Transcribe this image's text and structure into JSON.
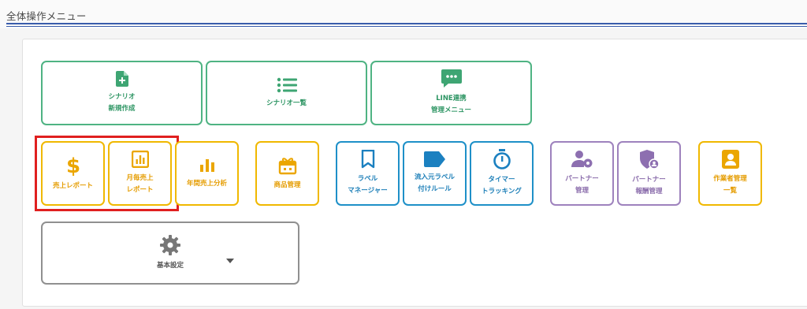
{
  "page": {
    "title": "全体操作メニュー"
  },
  "colors": {
    "green": "#4fb383",
    "orange": "#f0b800",
    "blue": "#1e90c8",
    "purple": "#9e82bd",
    "gray": "#909090",
    "highlight": "#e02020"
  },
  "scenario_menu": [
    {
      "label": "シナリオ\n新規作成",
      "icon": "file-plus-icon"
    },
    {
      "label": "シナリオ一覧",
      "icon": "list-icon"
    },
    {
      "label": "LINE連携\n管理メニュー",
      "icon": "chat-icon"
    }
  ],
  "sales_menu": [
    {
      "label": "売上レポート",
      "icon": "dollar-icon"
    },
    {
      "label": "月毎売上\nレポート",
      "icon": "bar-chart-square-icon"
    },
    {
      "label": "年間売上分析",
      "icon": "bar-chart-icon"
    },
    {
      "label": "商品管理",
      "icon": "gift-box-icon"
    }
  ],
  "tracking_menu": [
    {
      "label": "ラベル\nマネージャー",
      "icon": "bookmark-icon"
    },
    {
      "label": "流入元ラベル\n付けルール",
      "icon": "tag-icon"
    },
    {
      "label": "タイマー\nトラッキング",
      "icon": "stopwatch-icon"
    }
  ],
  "partner_menu": [
    {
      "label": "パートナー\n管理",
      "icon": "user-gear-icon"
    },
    {
      "label": "パートナー\n報酬管理",
      "icon": "shield-user-icon"
    }
  ],
  "worker_menu": [
    {
      "label": "作業者管理\n一覧",
      "icon": "id-card-icon"
    }
  ],
  "settings_menu": {
    "label": "基本設定",
    "icon": "gear-icon",
    "dropdown_icon": "caret-down-icon"
  }
}
